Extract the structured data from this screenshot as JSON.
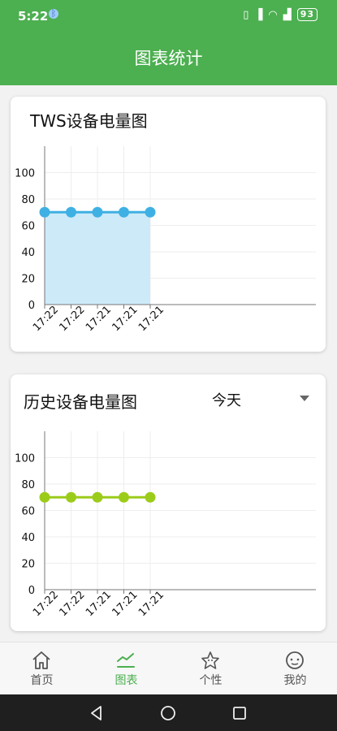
{
  "status": {
    "time": "5:22",
    "battery": "93",
    "bluetooth_icon": "bluetooth-icon",
    "icons": [
      "vibrate-icon",
      "nfc-icon",
      "wifi-icon",
      "signal-icon"
    ]
  },
  "appbar": {
    "title": "图表统计"
  },
  "card_tws": {
    "title": "TWS设备电量图"
  },
  "card_history": {
    "title": "历史设备电量图",
    "dropdown_value": "今天"
  },
  "colors": {
    "brand": "#4caf50",
    "tws_line": "#3fb0e3",
    "tws_fill": "#cdeaf8",
    "history_line": "#9ccc1a"
  },
  "chart_data": [
    {
      "type": "area",
      "categories": [
        "17:22",
        "17:22",
        "17:21",
        "17:21",
        "17:21"
      ],
      "series": [
        {
          "values": [
            70,
            70,
            70,
            70,
            70
          ]
        }
      ],
      "ylim": [
        0,
        120
      ],
      "yticks": [
        0,
        20,
        40,
        60,
        80,
        100
      ],
      "grid": true
    },
    {
      "type": "line",
      "categories": [
        "17:22",
        "17:22",
        "17:21",
        "17:21",
        "17:21"
      ],
      "series": [
        {
          "values": [
            70,
            70,
            70,
            70,
            70
          ]
        }
      ],
      "ylim": [
        0,
        120
      ],
      "yticks": [
        0,
        20,
        40,
        60,
        80,
        100
      ],
      "grid": true
    }
  ],
  "nav": {
    "items": [
      {
        "label": "首页",
        "icon": "home-icon"
      },
      {
        "label": "图表",
        "icon": "chart-icon"
      },
      {
        "label": "个性",
        "icon": "personalize-icon"
      },
      {
        "label": "我的",
        "icon": "profile-icon"
      }
    ]
  },
  "system_nav": [
    "back-icon",
    "home-circle-icon",
    "recents-icon"
  ]
}
